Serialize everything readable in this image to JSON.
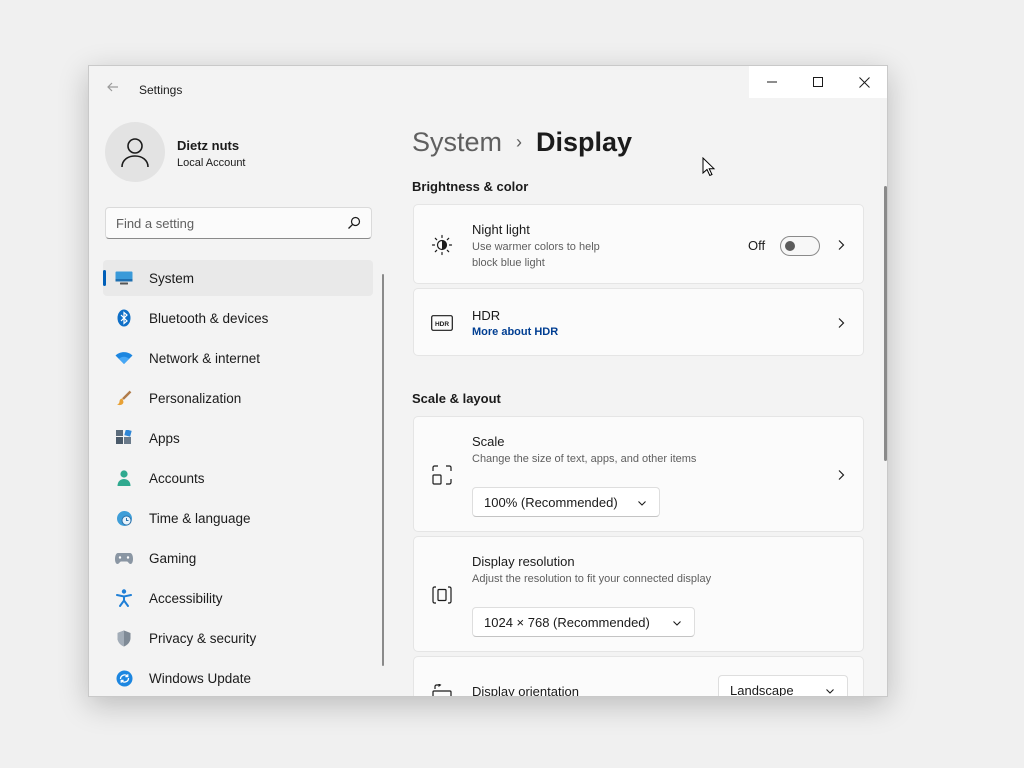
{
  "app": {
    "title": "Settings"
  },
  "user": {
    "name": "Dietz nuts",
    "account_type": "Local Account"
  },
  "search": {
    "placeholder": "Find a setting"
  },
  "sidebar": {
    "items": [
      {
        "label": "System",
        "icon": "monitor-icon",
        "active": true
      },
      {
        "label": "Bluetooth & devices",
        "icon": "bluetooth-icon"
      },
      {
        "label": "Network & internet",
        "icon": "wifi-icon"
      },
      {
        "label": "Personalization",
        "icon": "brush-icon"
      },
      {
        "label": "Apps",
        "icon": "apps-icon"
      },
      {
        "label": "Accounts",
        "icon": "person-icon"
      },
      {
        "label": "Time & language",
        "icon": "globe-clock-icon"
      },
      {
        "label": "Gaming",
        "icon": "gamepad-icon"
      },
      {
        "label": "Accessibility",
        "icon": "accessibility-icon"
      },
      {
        "label": "Privacy & security",
        "icon": "shield-icon"
      },
      {
        "label": "Windows Update",
        "icon": "update-icon"
      }
    ]
  },
  "breadcrumb": {
    "parent": "System",
    "separator": "›",
    "current": "Display"
  },
  "sections": {
    "brightness": "Brightness & color",
    "scale_layout": "Scale & layout"
  },
  "night_light": {
    "title": "Night light",
    "description_line1": "Use warmer colors to help",
    "description_line2": "block blue light",
    "state_label": "Off",
    "enabled": false
  },
  "hdr": {
    "title": "HDR",
    "link": "More about HDR"
  },
  "scale": {
    "title": "Scale",
    "description": "Change the size of text, apps, and other items",
    "value": "100% (Recommended)"
  },
  "resolution": {
    "title": "Display resolution",
    "description": "Adjust the resolution to fit your connected display",
    "value": "1024 × 768 (Recommended)"
  },
  "orientation": {
    "title": "Display orientation",
    "value": "Landscape"
  },
  "colors": {
    "accent": "#005fb8",
    "link": "#003e92",
    "window_bg": "#f3f3f3",
    "card_bg": "#fbfbfb"
  }
}
